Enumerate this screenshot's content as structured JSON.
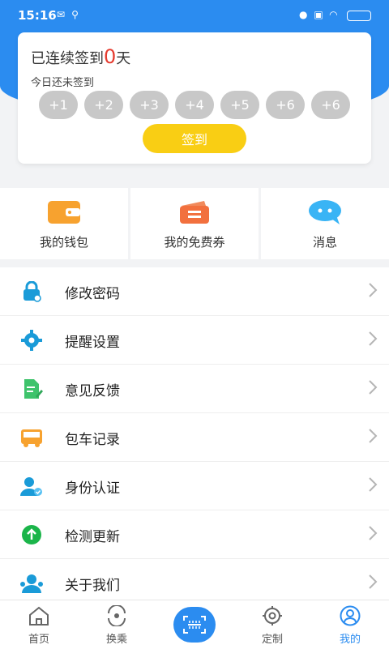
{
  "status_bar": {
    "time": "15:16",
    "battery_label": ""
  },
  "checkin": {
    "streak_prefix": "已连续签到",
    "streak_days": "0",
    "streak_suffix": "天",
    "today_status": "今日还未签到",
    "days": [
      "+1",
      "+2",
      "+3",
      "+4",
      "+5",
      "+6",
      "+6"
    ],
    "button_label": "签到"
  },
  "quick_links": [
    {
      "label": "我的钱包",
      "icon": "wallet-icon"
    },
    {
      "label": "我的免费券",
      "icon": "coupon-icon"
    },
    {
      "label": "消息",
      "icon": "message-icon"
    }
  ],
  "menu": [
    {
      "label": "修改密码",
      "icon": "lock-icon"
    },
    {
      "label": "提醒设置",
      "icon": "gear-icon"
    },
    {
      "label": "意见反馈",
      "icon": "feedback-icon"
    },
    {
      "label": "包车记录",
      "icon": "bus-icon"
    },
    {
      "label": "身份认证",
      "icon": "user-verify-icon"
    },
    {
      "label": "检测更新",
      "icon": "update-icon"
    },
    {
      "label": "关于我们",
      "icon": "about-icon"
    }
  ],
  "tabs": [
    {
      "label": "首页",
      "icon": "home-icon",
      "active": false
    },
    {
      "label": "换乘",
      "icon": "transfer-icon",
      "active": false
    },
    {
      "label": "定制",
      "icon": "custom-icon",
      "active": false
    },
    {
      "label": "我的",
      "icon": "profile-icon",
      "active": true
    }
  ],
  "colors": {
    "primary": "#2b8cf0",
    "accent_red": "#e53b2f",
    "button_yellow": "#f9ce14",
    "bubble_gray": "#c8c8c8"
  }
}
